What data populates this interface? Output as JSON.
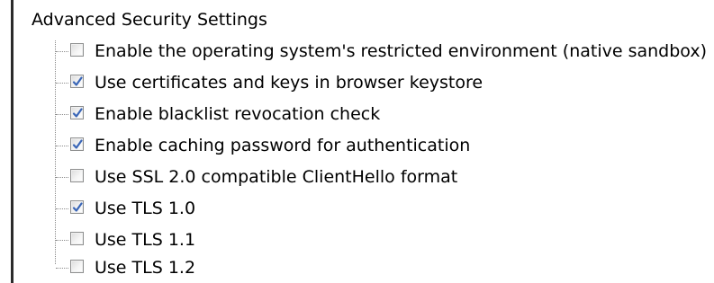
{
  "group": {
    "title": "Advanced Security Settings"
  },
  "items": [
    {
      "label": "Enable the operating system's restricted environment (native sandbox)",
      "checked": false
    },
    {
      "label": "Use certificates and keys in browser keystore",
      "checked": true
    },
    {
      "label": "Enable blacklist revocation check",
      "checked": true
    },
    {
      "label": "Enable caching password for authentication",
      "checked": true
    },
    {
      "label": "Use SSL 2.0 compatible ClientHello format",
      "checked": false
    },
    {
      "label": "Use TLS 1.0",
      "checked": true
    },
    {
      "label": "Use TLS 1.1",
      "checked": false
    },
    {
      "label": "Use TLS 1.2",
      "checked": false
    }
  ],
  "colors": {
    "checkmark": "#3a66b7",
    "border": "#2b2b2b"
  },
  "icons": {
    "checkmark": "checkmark-icon"
  }
}
